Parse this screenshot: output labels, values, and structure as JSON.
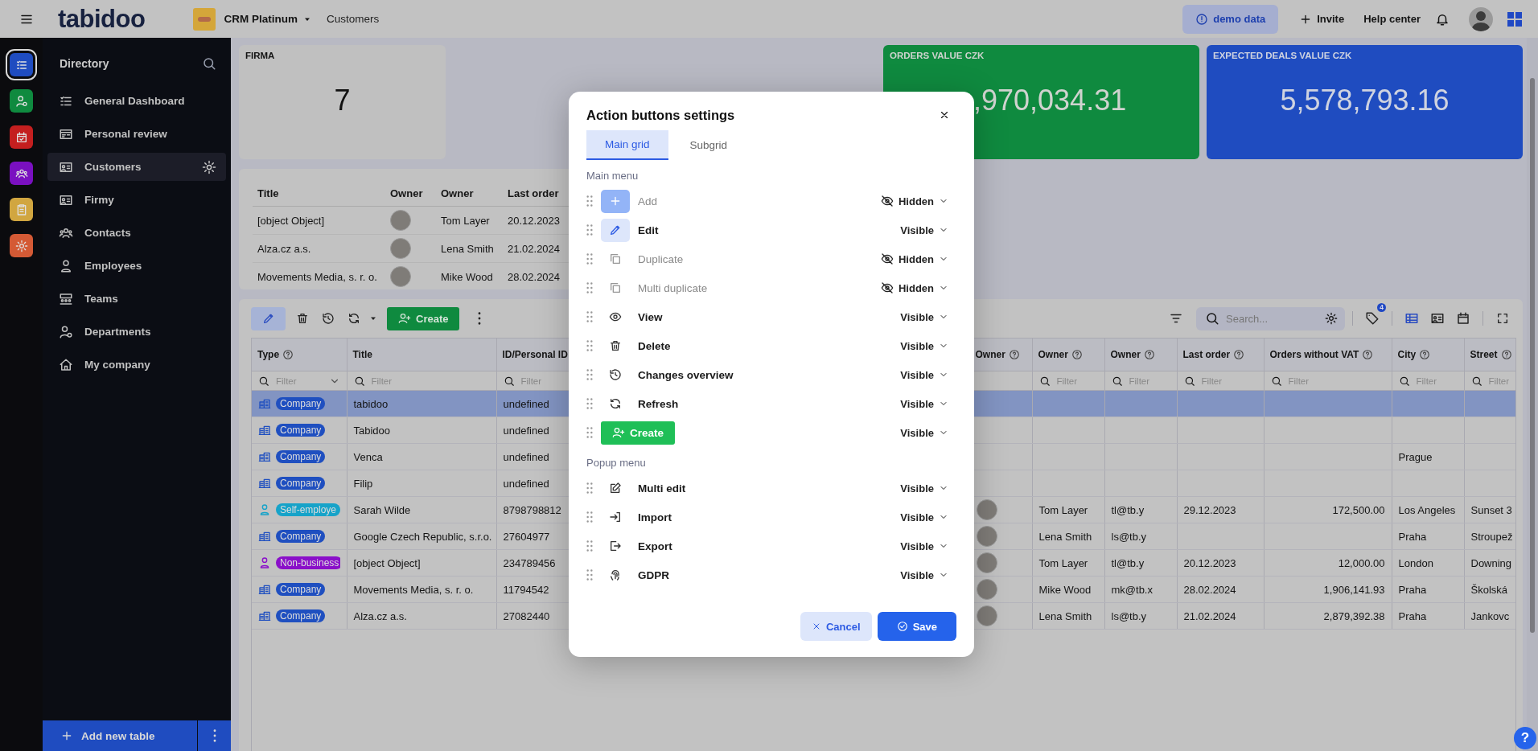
{
  "top_bar": {
    "logo": "tabidoo",
    "app_name": "CRM Platinum",
    "breadcrumb": "Customers",
    "demo_button": "demo data",
    "invite_button": "Invite",
    "help_link": "Help center"
  },
  "rail": [
    {
      "color": "#1f4cc0",
      "selected": true
    },
    {
      "color": "#0f8a3f",
      "selected": false
    },
    {
      "color": "#c41f1f",
      "selected": false
    },
    {
      "color": "#7a10c0",
      "selected": false
    },
    {
      "color": "#d1a640",
      "selected": false
    },
    {
      "color": "#d45a35",
      "selected": false
    }
  ],
  "sidebar": {
    "title": "Directory",
    "items": [
      {
        "label": "General Dashboard",
        "selected": false
      },
      {
        "label": "Personal review",
        "selected": false
      },
      {
        "label": "Customers",
        "selected": true
      },
      {
        "label": "Firmy",
        "selected": false
      },
      {
        "label": "Contacts",
        "selected": false
      },
      {
        "label": "Employees",
        "selected": false
      },
      {
        "label": "Teams",
        "selected": false
      },
      {
        "label": "Departments",
        "selected": false
      },
      {
        "label": "My company",
        "selected": false
      }
    ],
    "add_button": "Add new table"
  },
  "stat_cards": [
    {
      "title": "FIRMA",
      "value": "7",
      "kind": "plain"
    },
    {
      "title": "ORDERS VALUE CZK",
      "value": ",970,034.31",
      "kind": "green"
    },
    {
      "title": "EXPECTED DEALS VALUE CZK",
      "value": "5,578,793.16",
      "kind": "blue"
    }
  ],
  "summary_table": {
    "columns": [
      "Title",
      "Owner",
      "Owner",
      "Last order"
    ],
    "rows": [
      {
        "title": "[object Object]",
        "avatar": true,
        "owner": "Tom Layer",
        "last_order": "20.12.2023"
      },
      {
        "title": "Alza.cz a.s.",
        "avatar": true,
        "owner": "Lena Smith",
        "last_order": "21.02.2024"
      },
      {
        "title": "Movements Media, s. r. o.",
        "avatar": true,
        "owner": "Mike Wood",
        "last_order": "28.02.2024"
      }
    ]
  },
  "grid": {
    "toolbar": {
      "create_button": "Create",
      "search_placeholder": "Search...",
      "tag_count": "4"
    },
    "columns": [
      {
        "label": "Type",
        "help": true,
        "placeholder": "Filter",
        "dropdown": true
      },
      {
        "label": "Title",
        "help": false,
        "placeholder": "Filter"
      },
      {
        "label": "ID/Personal ID",
        "help": false,
        "placeholder": "Filter"
      },
      {
        "label": "Owner",
        "help": true
      },
      {
        "label": "Owner",
        "help": true,
        "placeholder": "Filter"
      },
      {
        "label": "Owner",
        "help": true,
        "placeholder": "Filter"
      },
      {
        "label": "Last order",
        "help": true,
        "placeholder": "Filter"
      },
      {
        "label": "Orders without VAT",
        "help": true,
        "placeholder": "Filter"
      },
      {
        "label": "City",
        "help": true,
        "placeholder": "Filter"
      },
      {
        "label": "Street",
        "help": true,
        "placeholder": "Filter"
      }
    ],
    "rows": [
      {
        "selected": true,
        "type": {
          "label": "Company",
          "kind": "company",
          "color": "#1f4fc0"
        },
        "title": "tabidoo",
        "id": "undefined",
        "avatar": false
      },
      {
        "selected": false,
        "type": {
          "label": "Company",
          "kind": "company",
          "color": "#1f4fc0"
        },
        "title": "Tabidoo",
        "id": "undefined",
        "avatar": false
      },
      {
        "selected": false,
        "type": {
          "label": "Company",
          "kind": "company",
          "color": "#1f4fc0"
        },
        "title": "Venca",
        "id": "undefined",
        "avatar": false,
        "city": "Prague"
      },
      {
        "selected": false,
        "type": {
          "label": "Company",
          "kind": "company",
          "color": "#1f4fc0"
        },
        "title": "Filip",
        "id": "undefined",
        "avatar": false
      },
      {
        "selected": false,
        "type": {
          "label": "Self-employe",
          "kind": "person",
          "color": "#16a3c9"
        },
        "title": "Sarah Wilde",
        "id": "8798798812",
        "avatar": true,
        "owner": "Tom Layer",
        "email": "tl@tb.y",
        "last_order": "29.12.2023",
        "orders": "172,500.00",
        "city": "Los Angeles",
        "street": "Sunset 3"
      },
      {
        "selected": false,
        "type": {
          "label": "Company",
          "kind": "company",
          "color": "#1f4fc0"
        },
        "title": "Google Czech Republic, s.r.o.",
        "id": "27604977",
        "avatar": true,
        "owner": "Lena Smith",
        "email": "ls@tb.y",
        "city": "Praha",
        "street": "Stroupež"
      },
      {
        "selected": false,
        "type": {
          "label": "Non-business",
          "kind": "person",
          "color": "#8a10c9"
        },
        "title": "[object Object]",
        "id": "234789456",
        "avatar": true,
        "owner": "Tom Layer",
        "email": "tl@tb.y",
        "last_order": "20.12.2023",
        "orders": "12,000.00",
        "city": "London",
        "street": "Downing"
      },
      {
        "selected": false,
        "type": {
          "label": "Company",
          "kind": "company",
          "color": "#1f4fc0"
        },
        "title": "Movements Media, s. r. o.",
        "id": "11794542",
        "avatar": true,
        "owner": "Mike Wood",
        "email": "mk@tb.x",
        "last_order": "28.02.2024",
        "orders": "1,906,141.93",
        "city": "Praha",
        "street": "Školská"
      },
      {
        "selected": false,
        "type": {
          "label": "Company",
          "kind": "company",
          "color": "#1f4fc0"
        },
        "title": "Alza.cz a.s.",
        "id": "27082440",
        "avatar": true,
        "owner": "Lena Smith",
        "email": "ls@tb.y",
        "last_order": "21.02.2024",
        "orders": "2,879,392.38",
        "city": "Praha",
        "street": "Jankovc"
      }
    ]
  },
  "modal": {
    "title": "Action buttons settings",
    "tabs": [
      {
        "label": "Main grid",
        "selected": true
      },
      {
        "label": "Subgrid",
        "selected": false
      }
    ],
    "sections": [
      {
        "title": "Main menu",
        "items": [
          {
            "label": "Add",
            "kind": "solid",
            "hidden": true,
            "status": "Hidden"
          },
          {
            "label": "Edit",
            "kind": "tinted",
            "hidden": false,
            "status": "Visible"
          },
          {
            "label": "Duplicate",
            "kind": "plain",
            "hidden": true,
            "status": "Hidden"
          },
          {
            "label": "Multi duplicate",
            "kind": "plain",
            "hidden": true,
            "status": "Hidden"
          },
          {
            "label": "View",
            "kind": "plain",
            "hidden": false,
            "status": "Visible"
          },
          {
            "label": "Delete",
            "kind": "plain",
            "hidden": false,
            "status": "Visible"
          },
          {
            "label": "Changes overview",
            "kind": "plain",
            "hidden": false,
            "status": "Visible"
          },
          {
            "label": "Refresh",
            "kind": "plain",
            "hidden": false,
            "status": "Visible"
          },
          {
            "label": "Create",
            "kind": "button",
            "hidden": false,
            "status": "Visible"
          }
        ]
      },
      {
        "title": "Popup menu",
        "items": [
          {
            "label": "Multi edit",
            "kind": "plain",
            "hidden": false,
            "status": "Visible"
          },
          {
            "label": "Import",
            "kind": "plain",
            "hidden": false,
            "status": "Visible"
          },
          {
            "label": "Export",
            "kind": "plain",
            "hidden": false,
            "status": "Visible"
          },
          {
            "label": "GDPR",
            "kind": "plain",
            "hidden": false,
            "status": "Visible"
          }
        ]
      }
    ],
    "cancel_button": "Cancel",
    "save_button": "Save"
  },
  "help_button": "?"
}
